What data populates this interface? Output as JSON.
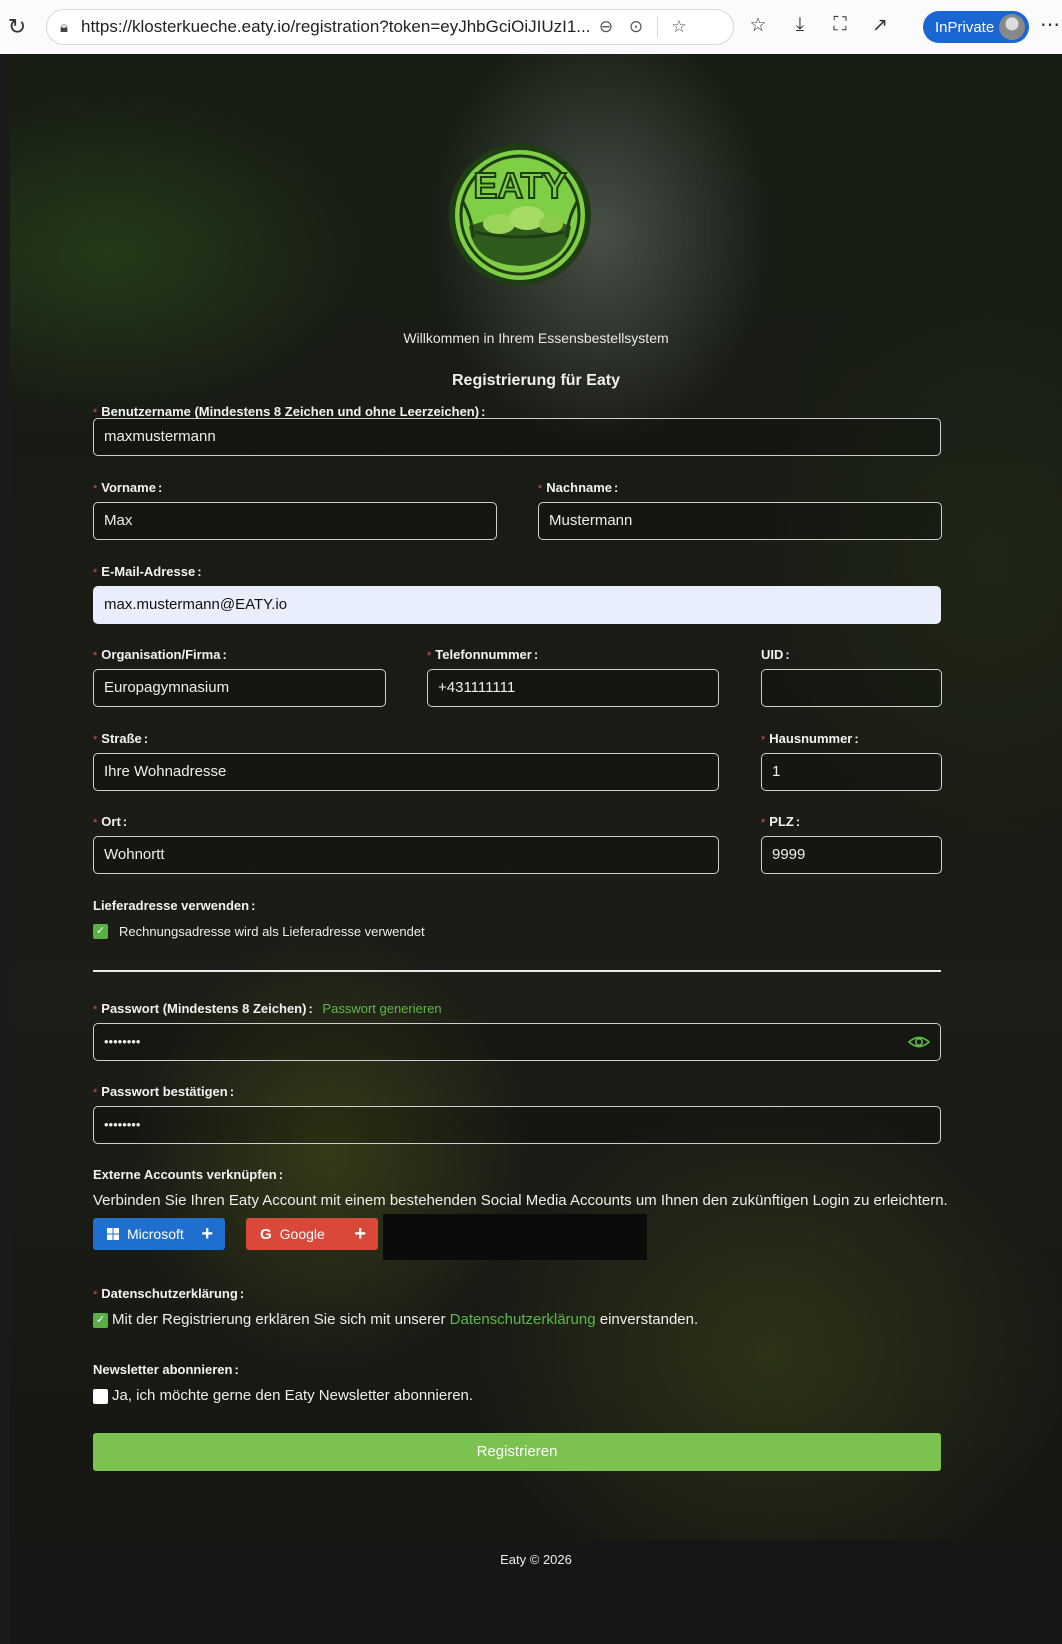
{
  "browser": {
    "url": "https://klosterkueche.eaty.io/registration?token=eyJhbGciOiJIUzI1...",
    "profile_label": "InPrivate"
  },
  "header": {
    "logo_text": "EATY",
    "welcome": "Willkommen in Ihrem Essensbestellsystem",
    "title": "Registrierung für Eaty"
  },
  "form": {
    "username": {
      "label": "Benutzername (Mindestens 8 Zeichen und ohne Leerzeichen)",
      "value": "maxmustermann"
    },
    "firstname": {
      "label": "Vorname",
      "value": "Max"
    },
    "lastname": {
      "label": "Nachname",
      "value": "Mustermann"
    },
    "email": {
      "label": "E-Mail-Adresse",
      "value": "max.mustermann@EATY.io"
    },
    "organisation": {
      "label": "Organisation/Firma",
      "value": "Europagymnasium"
    },
    "phone": {
      "label": "Telefonnummer",
      "value": "+431111111"
    },
    "uid": {
      "label": "UID",
      "value": ""
    },
    "street": {
      "label": "Straße",
      "value": "Ihre Wohnadresse"
    },
    "housenumber": {
      "label": "Hausnummer",
      "value": "1"
    },
    "city": {
      "label": "Ort",
      "value": "Wohnortt"
    },
    "zip": {
      "label": "PLZ",
      "value": "9999"
    },
    "delivery": {
      "label": "Lieferadresse verwenden",
      "checkbox_text": "Rechnungsadresse wird als Lieferadresse verwendet",
      "checked": true
    },
    "password": {
      "label": "Passwort (Mindestens 8 Zeichen)",
      "generate_link": "Passwort generieren",
      "value": "••••••••"
    },
    "password_confirm": {
      "label": "Passwort bestätigen",
      "value": "••••••••"
    },
    "external": {
      "label": "Externe Accounts verknüpfen",
      "description": "Verbinden Sie Ihren Eaty Account mit einem bestehenden Social Media Accounts um Ihnen den zukünftigen Login zu erleichtern.",
      "microsoft_label": "Microsoft",
      "google_label": "Google"
    },
    "privacy": {
      "label": "Datenschutzerklärung",
      "text_before": "Mit der Registrierung erklären Sie sich mit unserer",
      "link": "Datenschutzerklärung",
      "text_after": "einverstanden.",
      "checked": true
    },
    "newsletter": {
      "label": "Newsletter abonnieren",
      "text": "Ja, ich möchte gerne den Eaty Newsletter abonnieren.",
      "checked": false
    },
    "submit_label": "Registrieren"
  },
  "footer": {
    "text": "Eaty © 2026"
  },
  "colors": {
    "accent": "#7cc250",
    "link": "#5cb849",
    "required": "#e05050",
    "microsoft": "#1e6fd0",
    "google": "#d94838"
  }
}
